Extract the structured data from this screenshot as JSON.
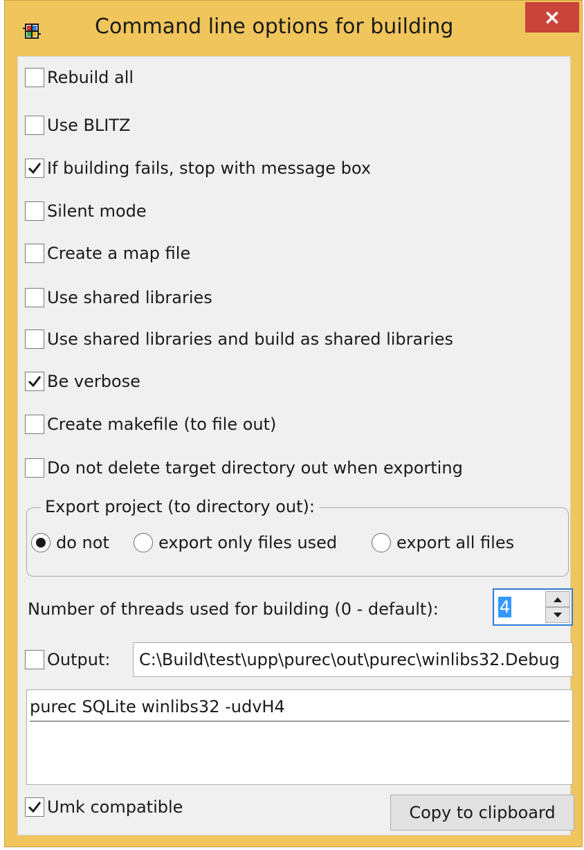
{
  "window": {
    "title": "Command line options for building",
    "close_glyph": "×",
    "app_icon": "package-icon",
    "accent_color": "#f0c55b",
    "close_color": "#c9443a"
  },
  "options": [
    {
      "label": "Rebuild all",
      "checked": false
    },
    {
      "label": "Use BLITZ",
      "checked": false
    },
    {
      "label": "If building fails, stop with message box",
      "checked": true
    },
    {
      "label": "Silent mode",
      "checked": false
    },
    {
      "label": "Create a map file",
      "checked": false
    },
    {
      "label": "Use shared libraries",
      "checked": false
    },
    {
      "label": "Use shared libraries and build as shared libraries",
      "checked": false
    },
    {
      "label": "Be verbose",
      "checked": true
    },
    {
      "label": "Create makefile (to file out)",
      "checked": false
    },
    {
      "label": "Do not delete target directory out when exporting",
      "checked": false
    }
  ],
  "export": {
    "title": "Export project (to directory out):",
    "choices": [
      {
        "label": "do not",
        "selected": true
      },
      {
        "label": "export only files used",
        "selected": false
      },
      {
        "label": "export all files",
        "selected": false
      }
    ]
  },
  "threads": {
    "label": "Number of threads used for building (0 - default):",
    "value": "4"
  },
  "output": {
    "label": "Output:",
    "checked": false,
    "value": "C:\\Build\\test\\upp\\purec\\out\\purec\\winlibs32.Debug"
  },
  "command_line": "purec SQLite winlibs32 -udvH4",
  "umk": {
    "label": "Umk compatible",
    "checked": true
  },
  "copy_button": "Copy to clipboard"
}
